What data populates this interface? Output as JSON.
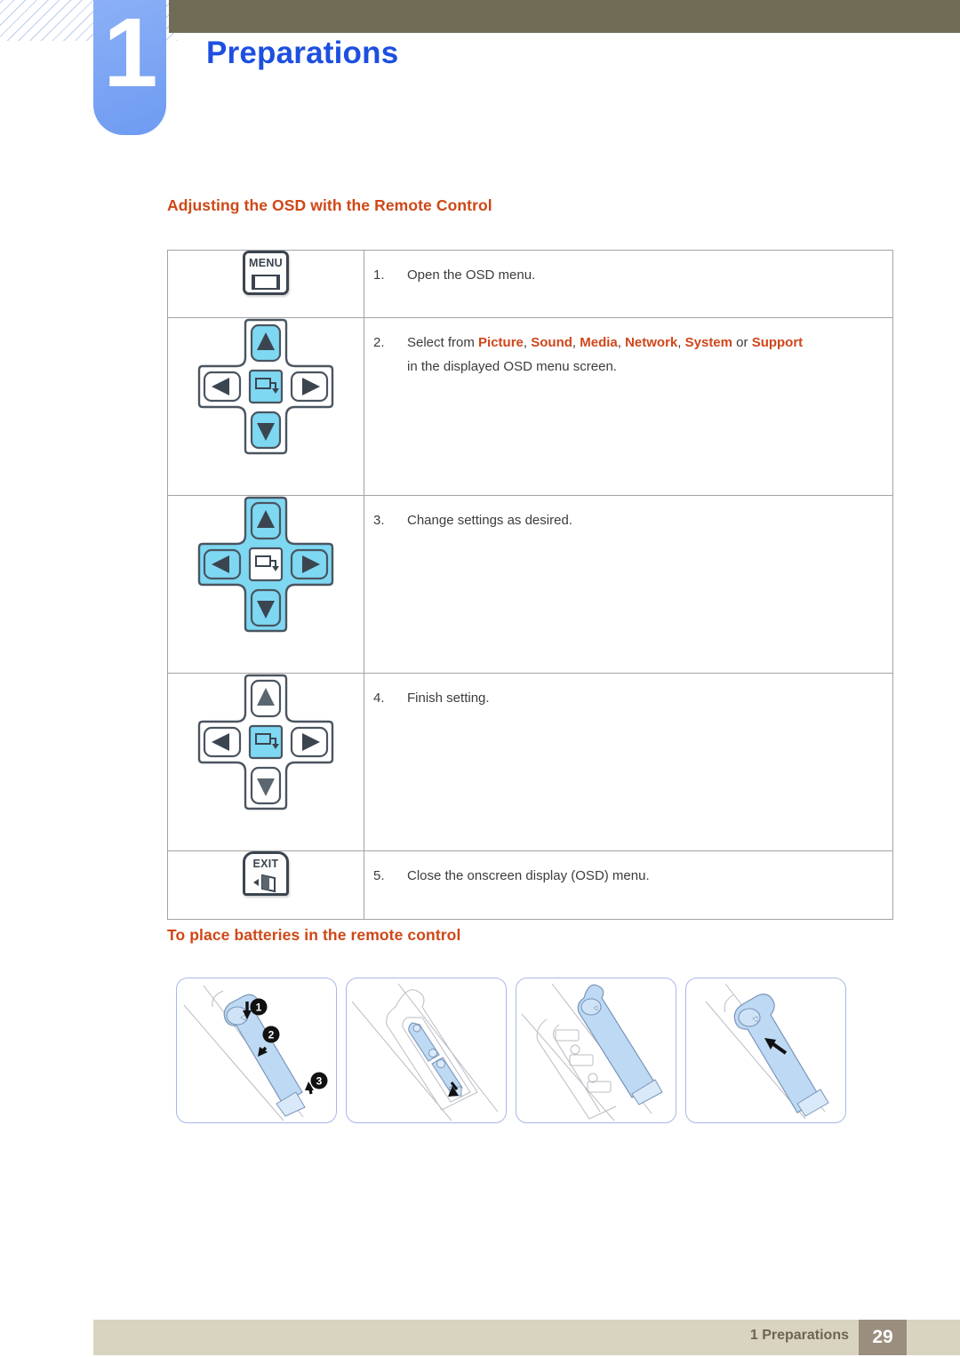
{
  "header": {
    "chapter_number": "1",
    "chapter_title": "Preparations",
    "bar_color": "#706c55",
    "number_bg_color": "#7ba4f3",
    "title_color": "#1d4fe0"
  },
  "headings": {
    "osd": "Adjusting the OSD with the Remote Control",
    "batteries": "To place batteries in the remote control",
    "color": "#cf4716"
  },
  "osd_table": {
    "rows": [
      {
        "icon": "menu-button-icon",
        "icon_label": "MENU",
        "number": "1.",
        "text": "Open the OSD menu.",
        "text2": ""
      },
      {
        "icon": "dpad-up-down-enter-icon",
        "icon_label": "",
        "number": "2.",
        "text": "Select from Picture, Sound, Media, Network, System or Support",
        "text2": "in the displayed OSD menu screen.",
        "keywords": [
          "Picture",
          "Sound",
          "Media",
          "Network",
          "System",
          "Support"
        ]
      },
      {
        "icon": "dpad-all-directions-icon",
        "icon_label": "",
        "number": "3.",
        "text": "Change settings as desired.",
        "text2": ""
      },
      {
        "icon": "dpad-enter-icon",
        "icon_label": "",
        "number": "4.",
        "text": "Finish setting.",
        "text2": ""
      },
      {
        "icon": "exit-button-icon",
        "icon_label": "EXIT",
        "number": "5.",
        "text": "Close the onscreen display (OSD) menu.",
        "text2": ""
      }
    ],
    "highlight_color": "#7ed8f2",
    "border_color": "#a3a3a3"
  },
  "battery_panels": [
    {
      "name": "panel-remove-cover",
      "callouts": [
        "1",
        "2",
        "3"
      ]
    },
    {
      "name": "panel-insert-batteries",
      "callouts": []
    },
    {
      "name": "panel-batteries-seated",
      "callouts": []
    },
    {
      "name": "panel-replace-cover",
      "callouts": []
    }
  ],
  "footer": {
    "text": "1 Preparations",
    "page": "29",
    "bar_color": "#d9d4c0",
    "page_bg_color": "#9b8e7e"
  }
}
